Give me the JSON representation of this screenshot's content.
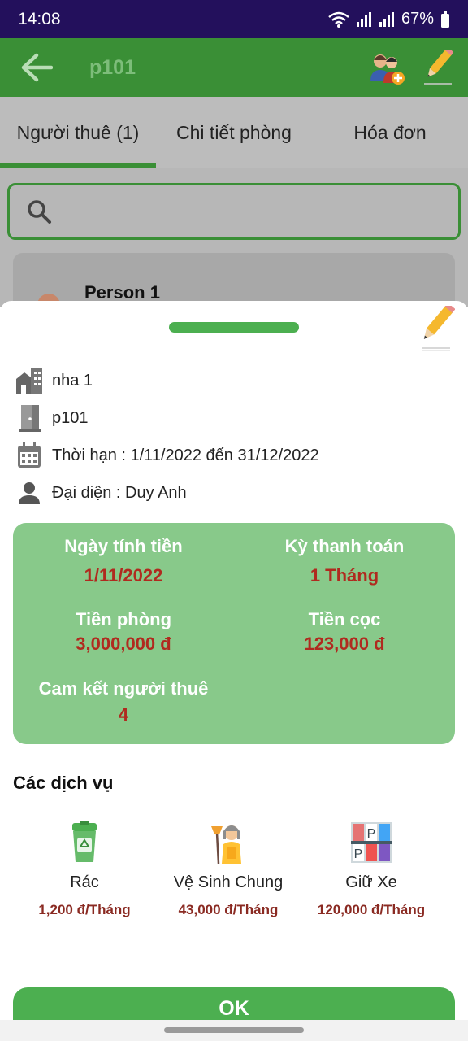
{
  "status": {
    "time": "14:08",
    "battery": "67%"
  },
  "app": {
    "title": "p101"
  },
  "tabs": [
    {
      "label": "Người thuê (1)",
      "active": true
    },
    {
      "label": "Chi tiết phòng",
      "active": false
    },
    {
      "label": "Hóa đơn",
      "active": false
    }
  ],
  "list": {
    "person_name": "Person 1"
  },
  "sheet": {
    "house": "nha 1",
    "room": "p101",
    "term": "Thời hạn : 1/11/2022 đến 31/12/2022",
    "representative": "Đại diện : Duy Anh",
    "summary": {
      "billing_date_label": "Ngày tính tiền",
      "billing_date_value": "1/11/2022",
      "payment_period_label": "Kỳ thanh toán",
      "payment_period_value": "1 Tháng",
      "rent_label": "Tiền phòng",
      "rent_value": "3,000,000 đ",
      "deposit_label": "Tiền cọc",
      "deposit_value": "123,000 đ",
      "commitment_label": "Cam kết người thuê",
      "commitment_value": "4"
    },
    "services_title": "Các dịch vụ",
    "services": [
      {
        "name": "Rác",
        "price": "1,200 đ/Tháng",
        "icon": "trash-bin-icon"
      },
      {
        "name": "Vệ Sinh Chung",
        "price": "43,000 đ/Tháng",
        "icon": "cleaner-icon"
      },
      {
        "name": "Giữ Xe",
        "price": "120,000 đ/Tháng",
        "icon": "parking-icon"
      }
    ],
    "ok_label": "OK"
  },
  "colors": {
    "app_bar": "#3a8f36",
    "status_bar": "#23105c",
    "summary_bg": "#88c98a",
    "value_red": "#b02a1f",
    "accent": "#4caf50"
  }
}
